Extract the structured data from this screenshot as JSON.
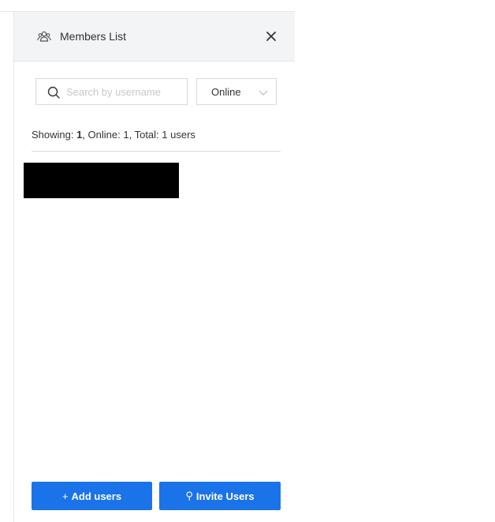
{
  "header": {
    "title": "Members List",
    "icon": "users-icon",
    "close_icon": "close-icon"
  },
  "search": {
    "placeholder": "Search by username",
    "value": ""
  },
  "status_filter": {
    "selected": "Online"
  },
  "summary": {
    "showing_label": "Showing: ",
    "showing_count": "1",
    "online_label": ", Online: ",
    "online_count": "1",
    "total_label": ", Total: ",
    "total_count": "1",
    "suffix": " users"
  },
  "actions": {
    "add_glyph": "+",
    "add_label": "Add users",
    "invite_glyph": "⚲",
    "invite_label": "Invite Users"
  },
  "colors": {
    "primary": "#1a73e8",
    "header_bg": "#f3f4f6",
    "border": "#d9d9d9"
  }
}
